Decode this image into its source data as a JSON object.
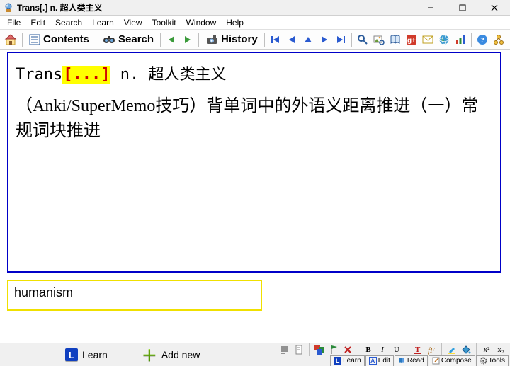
{
  "window": {
    "title": "Trans[.] n. 超人类主义"
  },
  "menu": {
    "file": "File",
    "edit": "Edit",
    "search": "Search",
    "learn": "Learn",
    "view": "View",
    "toolkit": "Toolkit",
    "window": "Window",
    "help": "Help"
  },
  "toolbar": {
    "contents": "Contents",
    "search": "Search",
    "history": "History"
  },
  "question": {
    "prefix": "Trans",
    "cloze": "[...]",
    "suffix": " n. 超人类主义",
    "body": "（Anki/SuperMemo技巧）背单词中的外语义距离推进（一）常规词块推进"
  },
  "answer": {
    "text": "humanism"
  },
  "bottom": {
    "learn": "Learn",
    "addnew": "Add new"
  },
  "status": {
    "learn": "Learn",
    "edit": "Edit",
    "read": "Read",
    "compose": "Compose",
    "tools": "Tools"
  },
  "fmt": {
    "bold": "B",
    "italic": "I",
    "underline": "U",
    "sup": "x²",
    "sub": "x₂"
  }
}
